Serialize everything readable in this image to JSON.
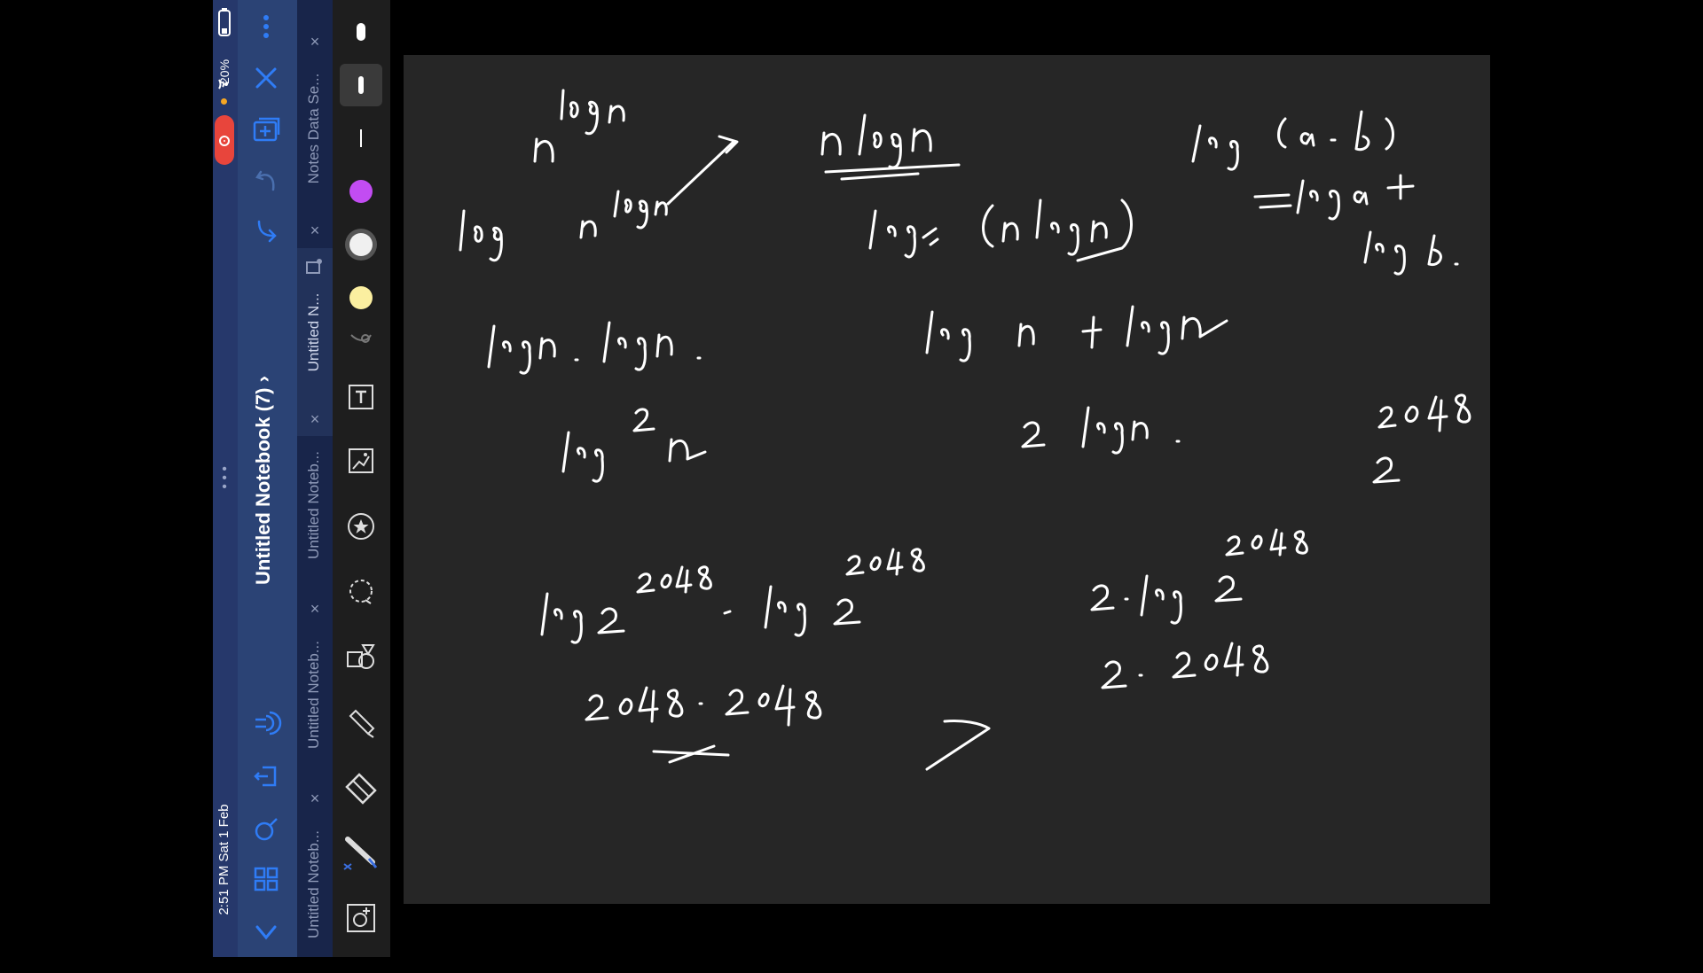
{
  "status_bar": {
    "time": "2:51 PM  Sat 1 Feb",
    "battery": "20%"
  },
  "notebook": {
    "title": "Untitled Notebook (7)",
    "chevron": "›"
  },
  "nav_icons": [
    "more-vertical-icon",
    "close-icon",
    "add-page-icon",
    "undo-icon",
    "redo-icon",
    "audio-icon",
    "export-icon",
    "search-icon",
    "grid-icon",
    "collapse-icon"
  ],
  "tabs": [
    {
      "label": "Notes Data Se...",
      "close": "×"
    },
    {
      "label": "Untitled N...",
      "close": "×"
    },
    {
      "label": "Untitled Noteb...",
      "close": "×"
    },
    {
      "label": "Untitled Noteb...",
      "close": "×"
    },
    {
      "label": "Untitled Noteb...",
      "close": "×"
    }
  ],
  "tools": [
    "pen-thickness-thick",
    "pen-thickness-medium",
    "pen-thickness-thin",
    "color-purple",
    "color-white",
    "color-yellow",
    "lasso-options",
    "text-tool",
    "image-tool",
    "sticker-tool",
    "lasso-tool",
    "shapes-tool",
    "highlighter-tool",
    "eraser-tool",
    "pen-tool",
    "add-element-tool"
  ],
  "colors": {
    "purple": "#c24cf2",
    "white": "#f0f0f0",
    "yellow": "#fbefa0",
    "accent": "#2f7cf6"
  },
  "handwriting": [
    "n",
    "log n",
    "log",
    "n",
    "log n",
    "n log n",
    "log. (n log n)",
    "log (a . b)",
    "= log a +",
    "log b.",
    "log n . log n .",
    "log n + log n",
    "log",
    "2",
    "n",
    "2 log n.",
    "2048",
    "2",
    "log 2",
    "2048",
    "- log 2",
    "2048",
    "2. log 2",
    "2048",
    "2. 2048",
    "2048 . 2048"
  ]
}
